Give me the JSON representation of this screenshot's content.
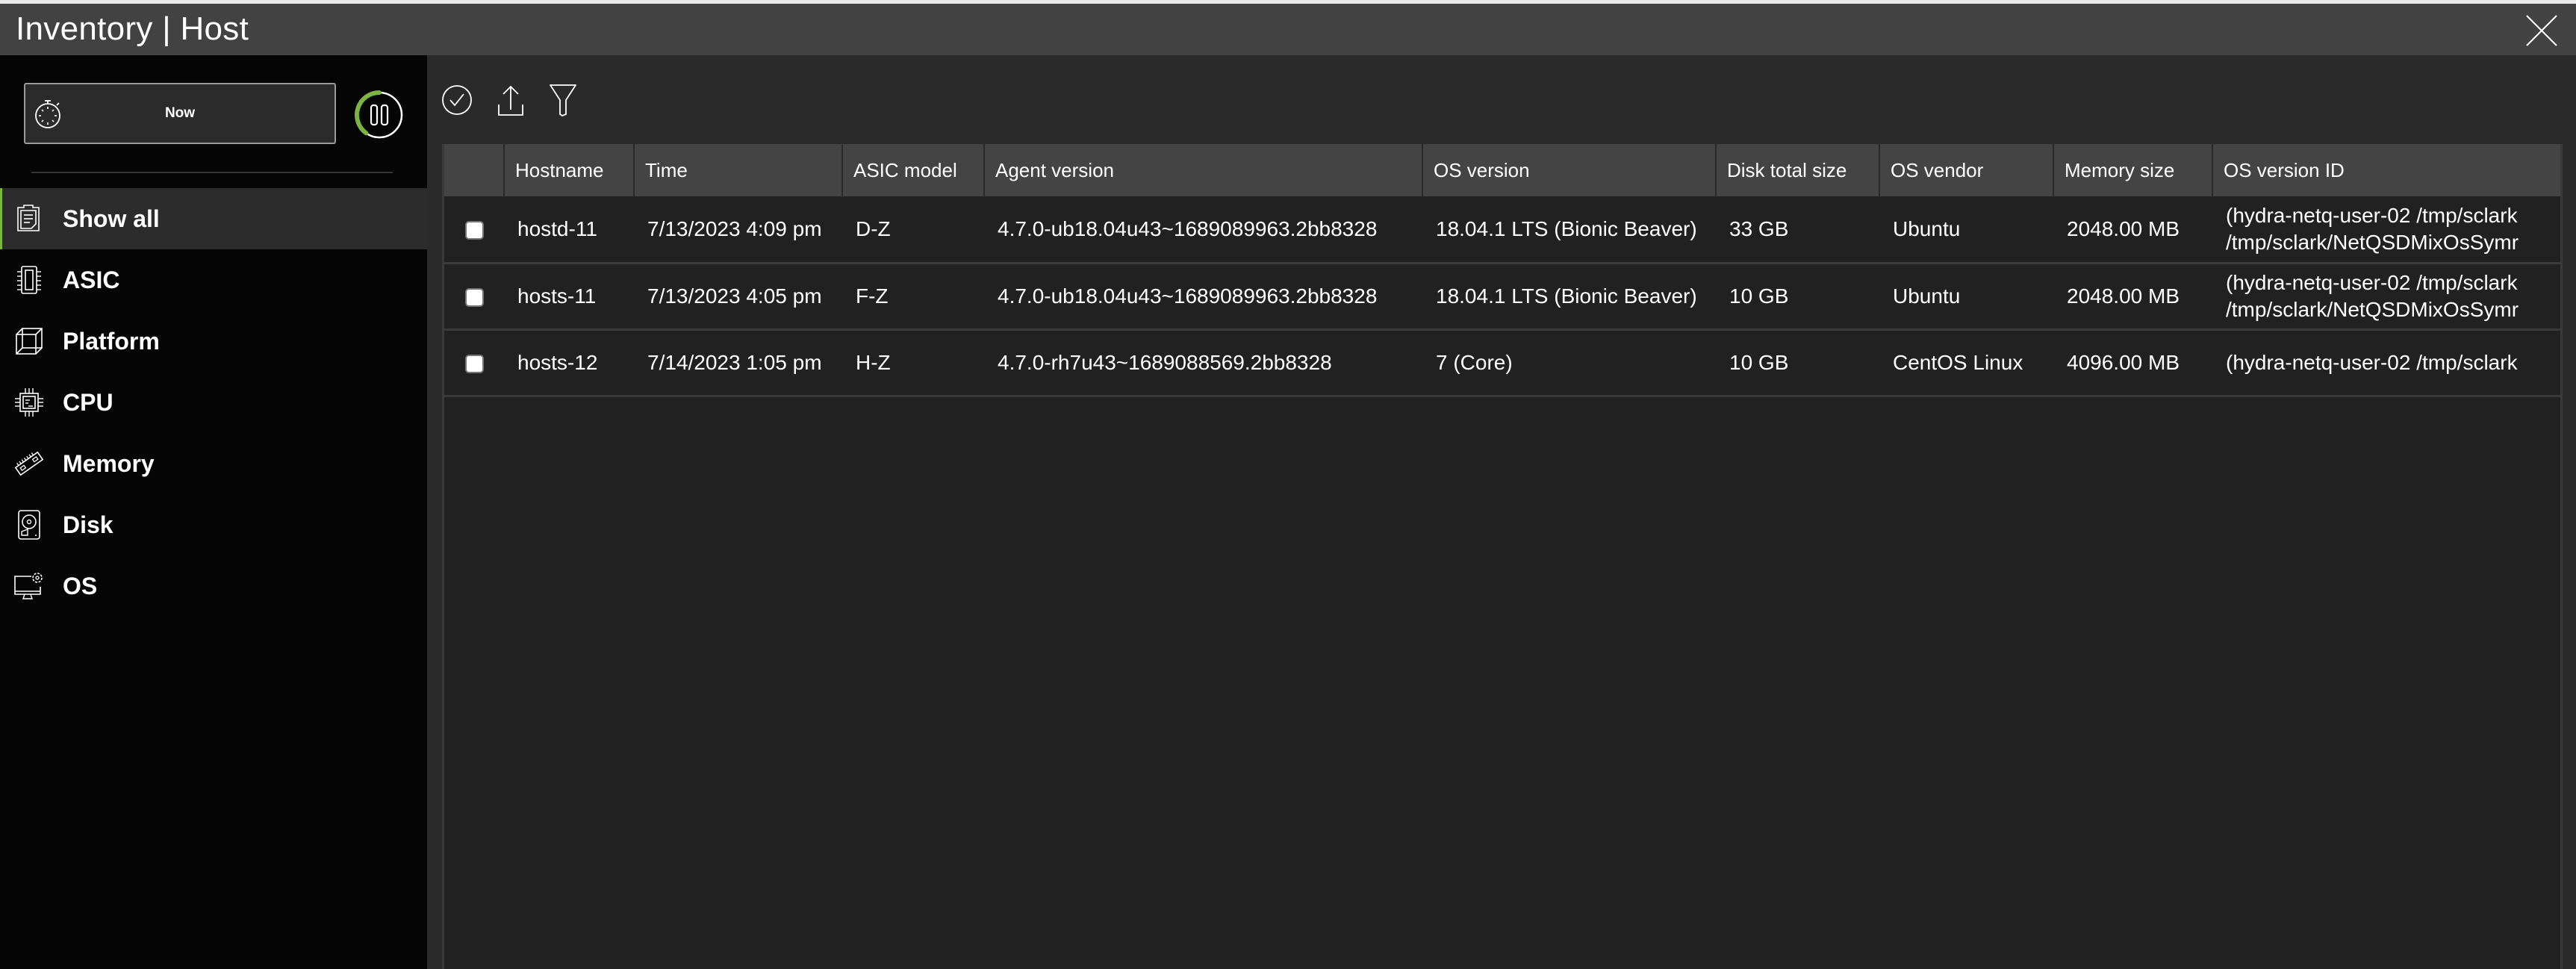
{
  "window": {
    "title": "Inventory | Host",
    "close_icon": "close-icon"
  },
  "time_control": {
    "label": "Now",
    "icon": "stopwatch-icon",
    "refresh_progress": 0.4,
    "accent_color": "#7cb342",
    "pause_icon": "pause-icon"
  },
  "sidebar": {
    "items": [
      {
        "label": "Show all",
        "icon": "clipboard-icon",
        "active": true
      },
      {
        "label": "ASIC",
        "icon": "asic-chip-icon",
        "active": false
      },
      {
        "label": "Platform",
        "icon": "cube-icon",
        "active": false
      },
      {
        "label": "CPU",
        "icon": "cpu-icon",
        "active": false
      },
      {
        "label": "Memory",
        "icon": "memory-stick-icon",
        "active": false
      },
      {
        "label": "Disk",
        "icon": "hard-disk-icon",
        "active": false
      },
      {
        "label": "OS",
        "icon": "monitor-gear-icon",
        "active": false
      }
    ]
  },
  "toolbar": {
    "select_all_icon": "check-circle-icon",
    "export_icon": "upload-icon",
    "filter_icon": "filter-icon"
  },
  "table": {
    "columns": [
      "",
      "Hostname",
      "Time",
      "ASIC model",
      "Agent version",
      "OS version",
      "Disk total size",
      "OS vendor",
      "Memory size",
      "OS version ID"
    ],
    "rows": [
      {
        "checked": false,
        "cells": [
          "hostd-11",
          "7/13/2023 4:09 pm",
          "D-Z",
          "4.7.0-ub18.04u43~1689089963.2bb8328",
          "18.04.1 LTS (Bionic Beaver)",
          "33 GB",
          "Ubuntu",
          "2048.00 MB",
          "(hydra-netq-user-02 /tmp/sclark /tmp/sclark/NetQSDMixOsSymr"
        ]
      },
      {
        "checked": false,
        "cells": [
          "hosts-11",
          "7/13/2023 4:05 pm",
          "F-Z",
          "4.7.0-ub18.04u43~1689089963.2bb8328",
          "18.04.1 LTS (Bionic Beaver)",
          "10 GB",
          "Ubuntu",
          "2048.00 MB",
          "(hydra-netq-user-02 /tmp/sclark /tmp/sclark/NetQSDMixOsSymr"
        ]
      },
      {
        "checked": false,
        "cells": [
          "hosts-12",
          "7/14/2023 1:05 pm",
          "H-Z",
          "4.7.0-rh7u43~1689088569.2bb8328",
          "7 (Core)",
          "10 GB",
          "CentOS Linux",
          "4096.00 MB",
          "(hydra-netq-user-02 /tmp/sclark"
        ]
      }
    ]
  }
}
